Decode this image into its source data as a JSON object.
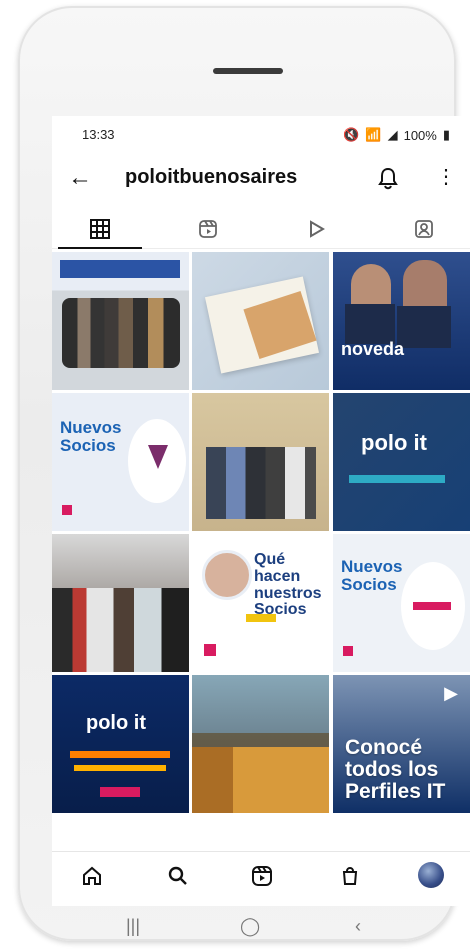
{
  "status": {
    "time": "13:33",
    "battery_percent": "100%"
  },
  "profile": {
    "username": "poloitbuenosaires"
  },
  "tabs": [
    {
      "name": "grid-icon",
      "active": true
    },
    {
      "name": "reels-icon",
      "active": false
    },
    {
      "name": "video-icon",
      "active": false
    },
    {
      "name": "tagged-icon",
      "active": false
    }
  ],
  "posts": [
    {
      "text": ""
    },
    {
      "text": ""
    },
    {
      "text": "noveda"
    },
    {
      "text": "Nuevos Socios"
    },
    {
      "text": ""
    },
    {
      "text": "polo it"
    },
    {
      "text": ""
    },
    {
      "text": "Qué hacen nuestros Socios"
    },
    {
      "text": "Nuevos Socios"
    },
    {
      "text": "polo it"
    },
    {
      "text": ""
    },
    {
      "text": "Conocé todos los Perfiles IT"
    }
  ],
  "bottom_nav": [
    "home-icon",
    "search-icon",
    "reels-icon",
    "shop-icon",
    "profile-avatar"
  ],
  "colors": {
    "text": "#111111",
    "muted": "#777777",
    "blue": "#0b2a6d"
  }
}
